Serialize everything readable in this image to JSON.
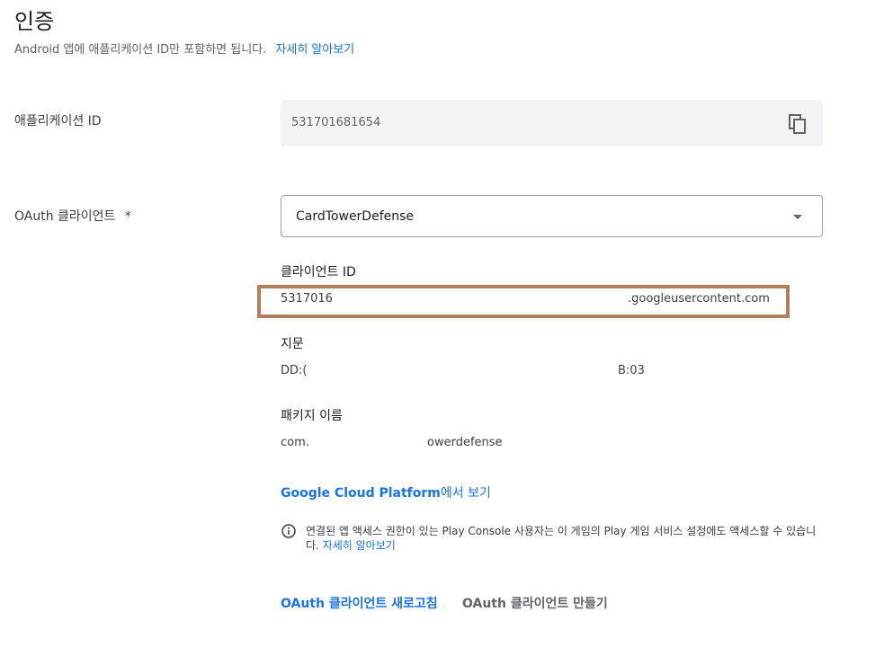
{
  "header": {
    "title": "인증",
    "subtitle": "Android 앱에 애플리케이션 ID만 포함하면 됩니다.",
    "learn_more": "자세히 알아보기"
  },
  "app_id": {
    "label": "애플리케이션 ID",
    "value": "531701681654",
    "copy_icon": "copy-icon"
  },
  "oauth": {
    "label": "OAuth 클라이언트",
    "required_mark": "*",
    "selected": "CardTowerDefense"
  },
  "client_id": {
    "label": "클라이언트 ID",
    "value_start": "5317016",
    "value_end": ".googleusercontent.com"
  },
  "fingerprint": {
    "label": "지문",
    "value_start": "DD:(",
    "value_end": "B:03"
  },
  "package": {
    "label": "패키지 이름",
    "value_start": "com.",
    "value_end": "owerdefense"
  },
  "gcp": {
    "link_bold": "Google Cloud Platform",
    "link_normal": "에서 보기"
  },
  "info": {
    "icon": "info-icon",
    "text": "연결된 앱 액세스 권한이 있는 Play Console 사용자는 이 게임의 Play 게임 서비스 설정에도 액세스할 수 있습니다.",
    "learn_more": "자세히 알아보기"
  },
  "actions": {
    "refresh": "OAuth 클라이언트 새로고침",
    "create": "OAuth 클라이언트 만들기"
  },
  "colors": {
    "link": "#1a73e8",
    "highlight": "#b0805c",
    "field_bg": "#f1f3f4"
  }
}
